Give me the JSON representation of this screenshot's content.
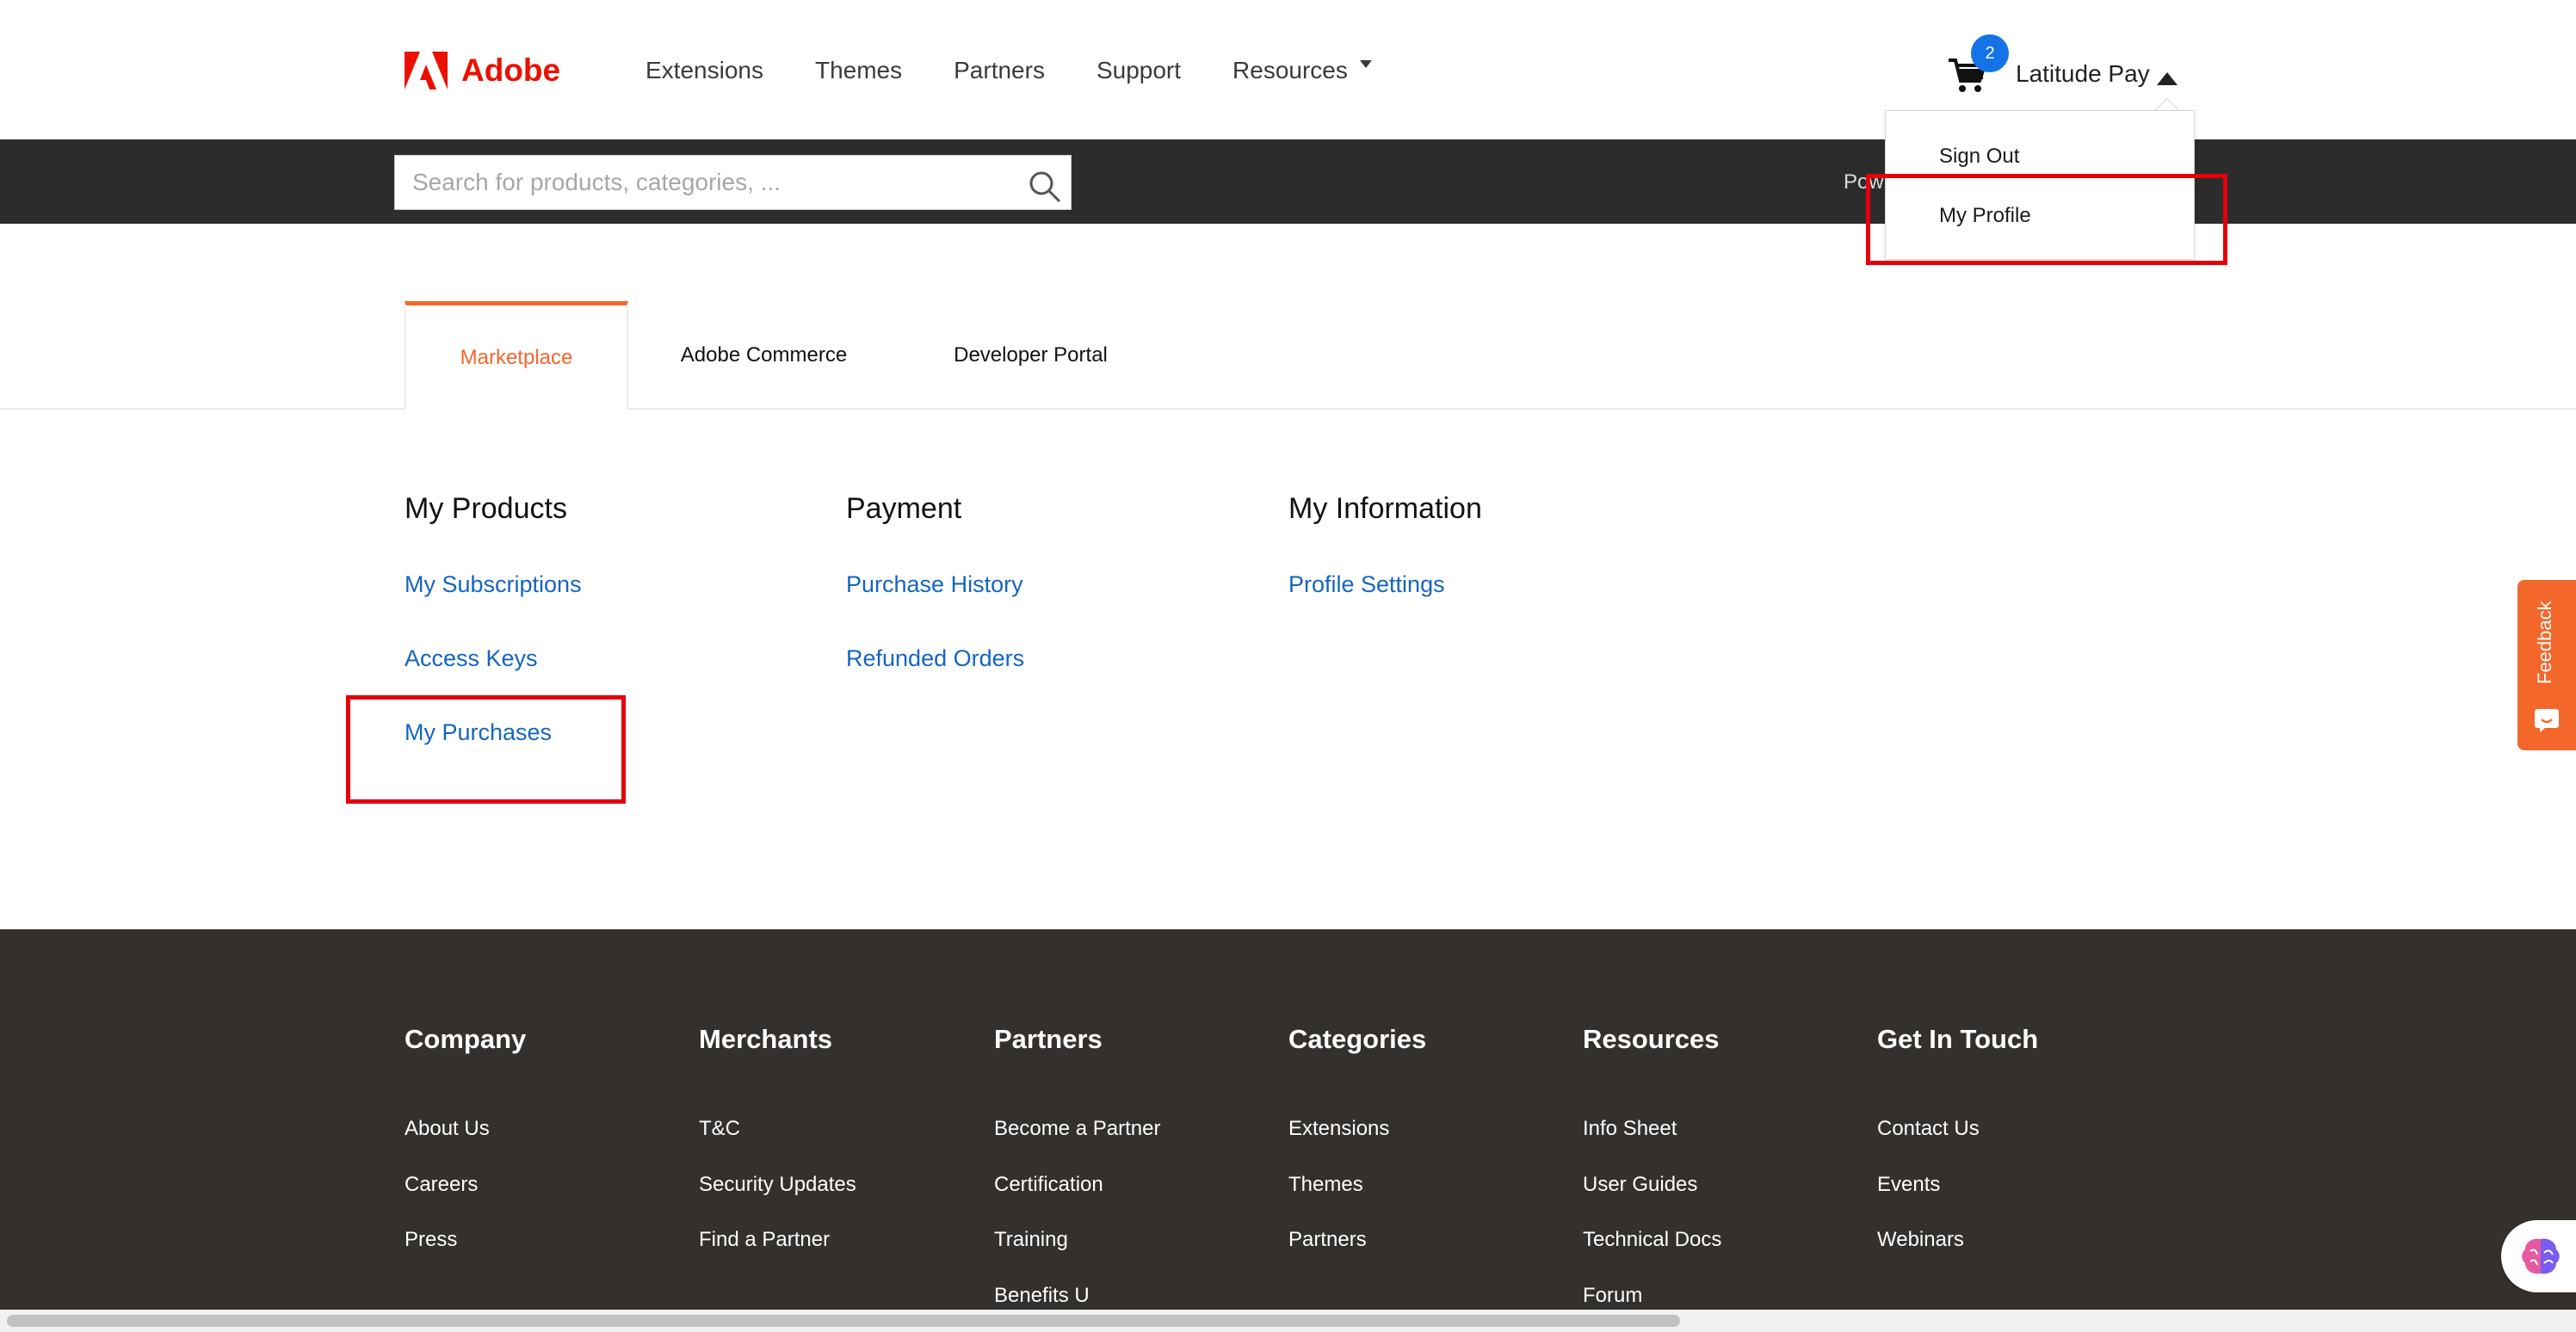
{
  "header": {
    "brand": "Adobe",
    "nav": [
      "Extensions",
      "Themes",
      "Partners",
      "Support",
      "Resources"
    ],
    "cart_count": "2",
    "user_name": "Latitude Pay"
  },
  "search": {
    "placeholder": "Search for products, categories, ...",
    "powered_text": "Pow"
  },
  "dropdown": {
    "items": [
      "Sign Out",
      "My Profile"
    ]
  },
  "tabs": [
    "Marketplace",
    "Adobe Commerce",
    "Developer Portal"
  ],
  "content": {
    "columns": [
      {
        "title": "My Products",
        "links": [
          "My Subscriptions",
          "Access Keys",
          "My Purchases"
        ]
      },
      {
        "title": "Payment",
        "links": [
          "Purchase History",
          "Refunded Orders"
        ]
      },
      {
        "title": "My Information",
        "links": [
          "Profile Settings"
        ]
      }
    ]
  },
  "feedback": {
    "label": "Feedback"
  },
  "footer": {
    "columns": [
      {
        "title": "Company",
        "links": [
          "About Us",
          "Careers",
          "Press"
        ]
      },
      {
        "title": "Merchants",
        "links": [
          "T&C",
          "Security Updates",
          "Find a Partner"
        ]
      },
      {
        "title": "Partners",
        "links": [
          "Become a Partner",
          "Certification",
          "Training",
          "Benefits U"
        ]
      },
      {
        "title": "Categories",
        "links": [
          "Extensions",
          "Themes",
          "Partners"
        ]
      },
      {
        "title": "Resources",
        "links": [
          "Info Sheet",
          "User Guides",
          "Technical Docs",
          "Forum"
        ]
      },
      {
        "title": "Get In Touch",
        "links": [
          "Contact Us",
          "Events",
          "Webinars"
        ]
      }
    ]
  },
  "colors": {
    "brand_red": "#eb1000",
    "accent_orange": "#f4672b",
    "link_blue": "#1565c0",
    "highlight_red": "#e5000a",
    "footer_bg": "#33302d"
  }
}
